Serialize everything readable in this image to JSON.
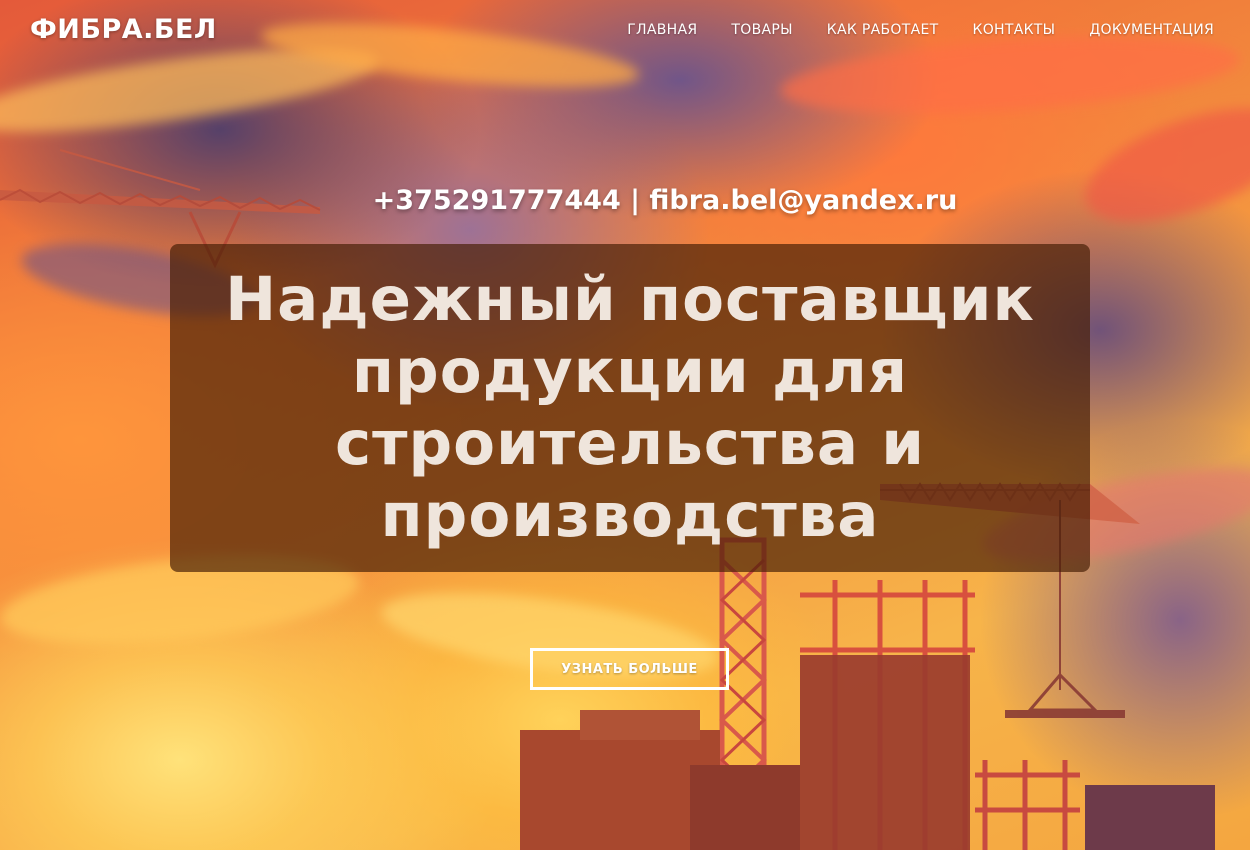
{
  "header": {
    "logo": "ФИБРА.БЕЛ",
    "nav": [
      {
        "label": "ГЛАВНАЯ"
      },
      {
        "label": "ТОВАРЫ"
      },
      {
        "label": "КАК РАБОТАЕТ"
      },
      {
        "label": "КОНТАКТЫ"
      },
      {
        "label": "ДОКУМЕНТАЦИЯ"
      }
    ]
  },
  "hero": {
    "contact_line": "+375291777444 | fibra.bel@yandex.ru",
    "headline": "Надежный поставщик продукции для строительства и производства",
    "cta_label": "УЗНАТЬ БОЛЬШЕ"
  },
  "colors": {
    "text": "#ffffff",
    "headline_text": "#efe5dc",
    "overlay": "#461e05",
    "sky_orange": "#f07a3a",
    "sky_yellow": "#ffd25a",
    "sky_purple": "#5a4682",
    "silhouette": "#a8482e"
  }
}
